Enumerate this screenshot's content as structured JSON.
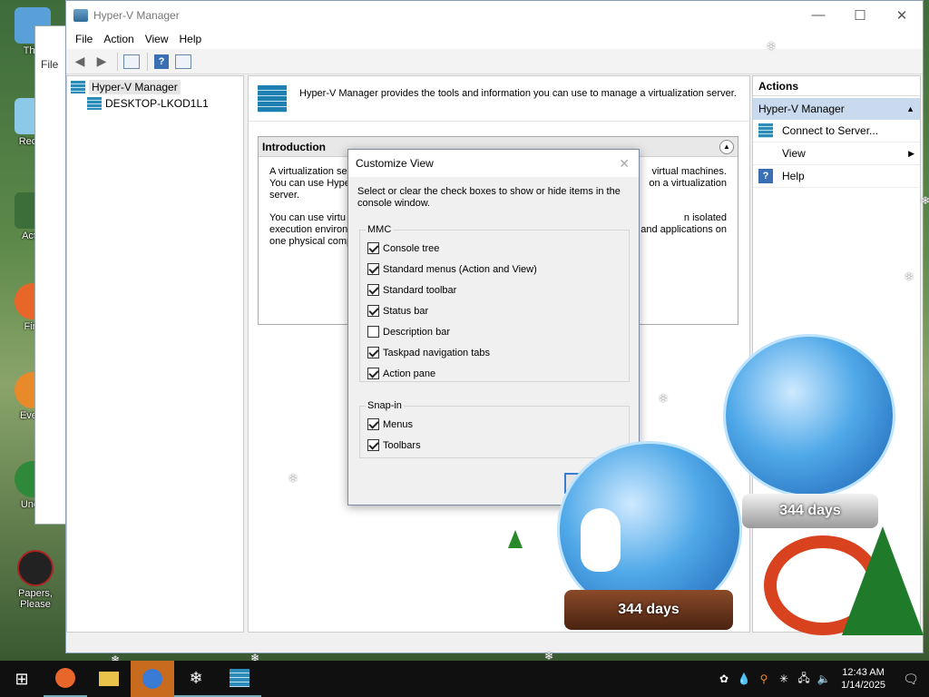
{
  "window": {
    "title": "Hyper-V Manager",
    "minimize": "—",
    "maximize": "☐",
    "close": "✕"
  },
  "menu": [
    "File",
    "Action",
    "View",
    "Help"
  ],
  "tree": {
    "root": "Hyper-V Manager",
    "child": "DESKTOP-LKOD1L1"
  },
  "banner": "Hyper-V Manager provides the tools and information you can use to manage a virtualization server.",
  "intro": {
    "header": "Introduction",
    "p1_left": "A virtualization ser",
    "p1_right": "virtual machines.",
    "p1_line2_left": "You can use Hype",
    "p1_line2_right": "on a virtualization",
    "p1_line3": "server.",
    "p2_left": "You can use virtu",
    "p2_right": "n isolated",
    "p2_line2_left": "execution environ",
    "p2_line2_right": "and applications on",
    "p2_line3": "one physical comp"
  },
  "actions": {
    "header": "Actions",
    "group": "Hyper-V Manager",
    "items": [
      "Connect to Server...",
      "View",
      "Help"
    ]
  },
  "dialog": {
    "title": "Customize View",
    "description": "Select or clear the check boxes to show or hide items in the console window.",
    "mmc_label": "MMC",
    "mmc_items": [
      {
        "label": "Console tree",
        "checked": true
      },
      {
        "label": "Standard menus (Action and View)",
        "checked": true
      },
      {
        "label": "Standard toolbar",
        "checked": true
      },
      {
        "label": "Status bar",
        "checked": true
      },
      {
        "label": "Description bar",
        "checked": false
      },
      {
        "label": "Taskpad navigation tabs",
        "checked": true
      },
      {
        "label": "Action pane",
        "checked": true
      }
    ],
    "snapin_label": "Snap-in",
    "snapin_items": [
      {
        "label": "Menus",
        "checked": true
      },
      {
        "label": "Toolbars",
        "checked": true
      }
    ]
  },
  "desktop_icons": [
    "This",
    "Recyc",
    "Activ",
    "Fire",
    "Every",
    "Unde",
    "Papers, Please"
  ],
  "bg_window": {
    "menu": "File"
  },
  "decor": {
    "globe_days": "344 days"
  },
  "taskbar": {
    "start": "⊞",
    "time": "12:43 AM",
    "date": "1/14/2025",
    "notification": "🗨"
  }
}
